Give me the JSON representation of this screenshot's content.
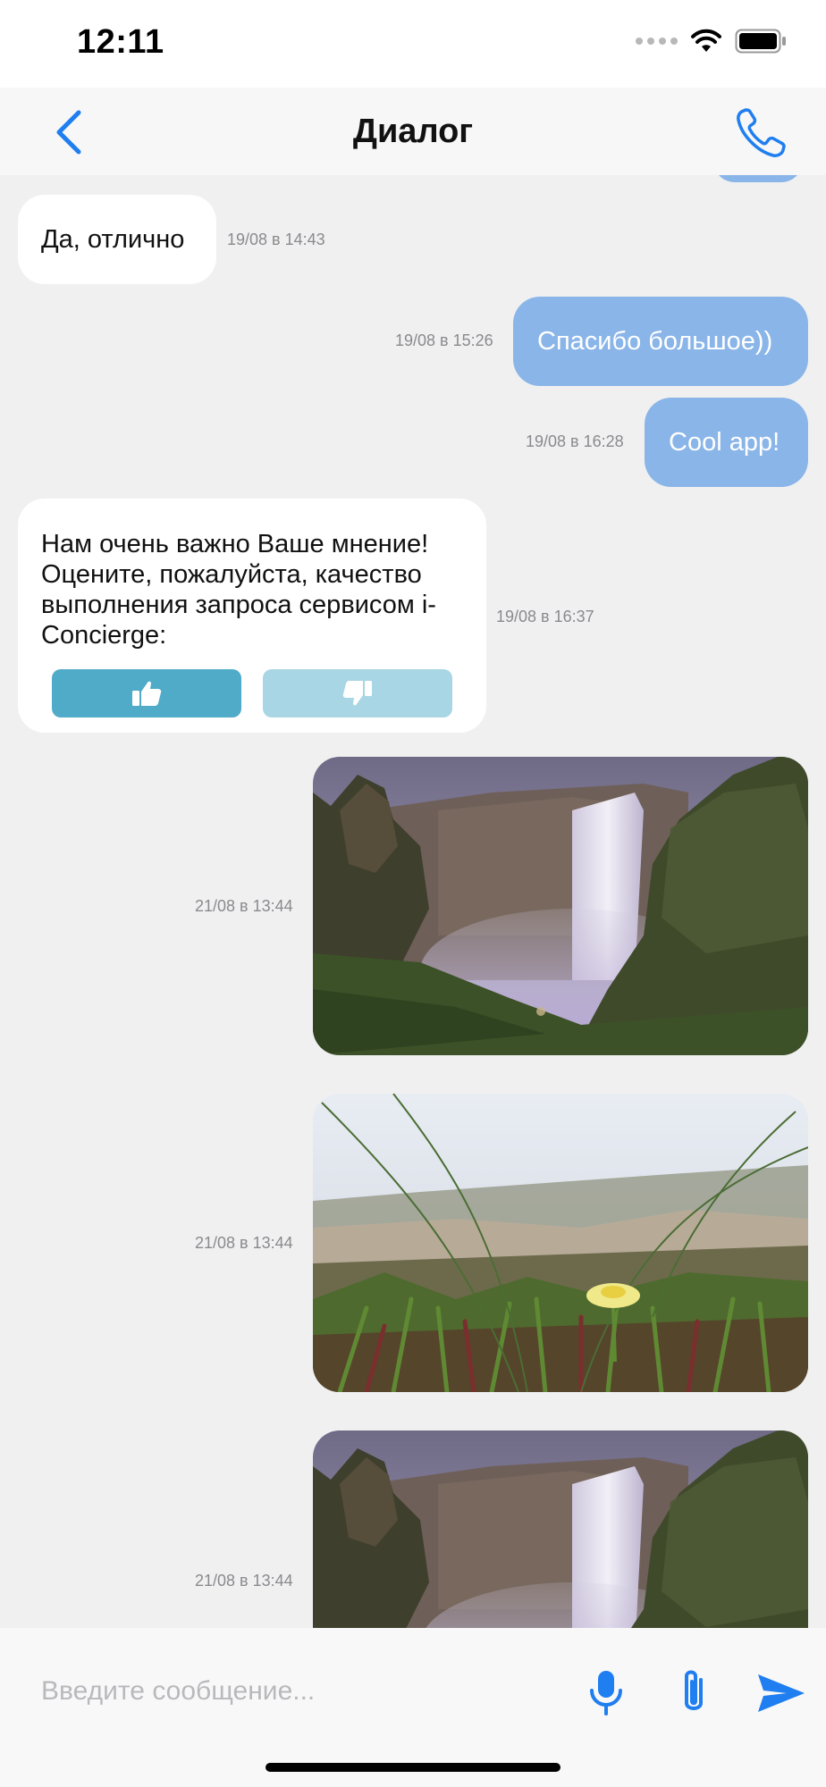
{
  "status_bar": {
    "time": "12:11"
  },
  "header": {
    "title": "Диалог"
  },
  "messages": [
    {
      "direction": "in",
      "text": "Да, отлично",
      "time": "19/08 в 14:43"
    },
    {
      "direction": "out",
      "text": "Спасибо большое))",
      "time": "19/08 в 15:26"
    },
    {
      "direction": "out",
      "text": "Cool app!",
      "time": "19/08 в 16:28"
    },
    {
      "direction": "in",
      "text": "Нам очень важно Ваше мнение! Оцените, пожалуйста, качество выполнения запроса сервисом i-Concierge:",
      "time": "19/08 в 16:37"
    },
    {
      "direction": "out",
      "type": "image",
      "subject": "waterfall",
      "time": "21/08 в 13:44"
    },
    {
      "direction": "out",
      "type": "image",
      "subject": "flower-in-grass",
      "time": "21/08 в 13:44"
    },
    {
      "direction": "out",
      "type": "image",
      "subject": "waterfall",
      "time": "21/08 в 13:44"
    }
  ],
  "feedback": {
    "like_icon": "thumbs-up-icon",
    "dislike_icon": "thumbs-down-icon"
  },
  "composer": {
    "placeholder": "Введите сообщение..."
  },
  "colors": {
    "accent": "#1f7ef0",
    "outgoing_bubble": "#8ab5e8",
    "like_button": "#50abc8",
    "dislike_button": "#a9d6e4",
    "background": "#f0f0f1"
  }
}
